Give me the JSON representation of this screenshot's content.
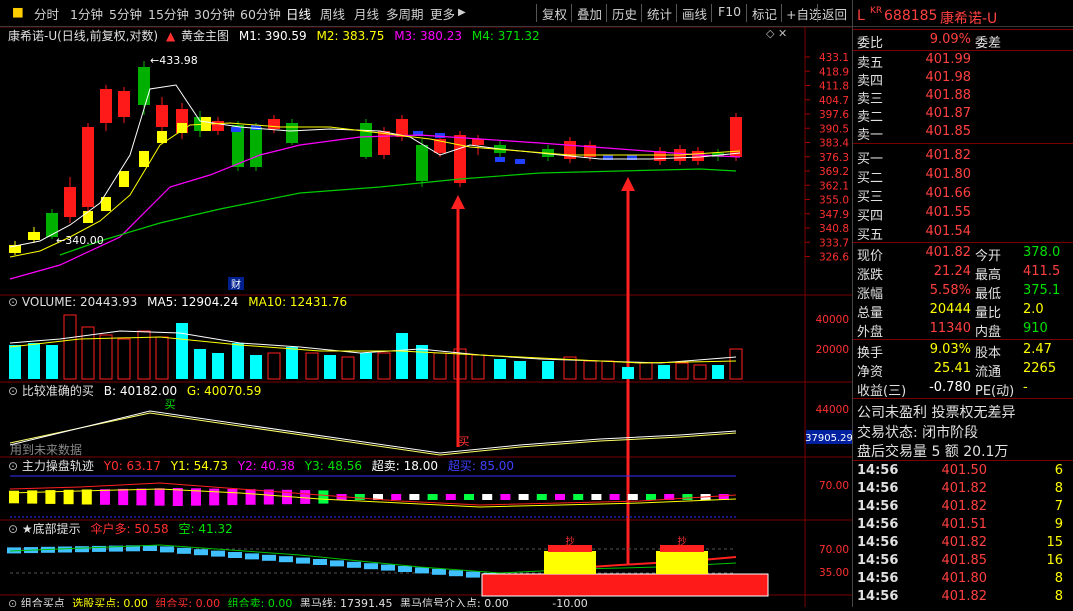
{
  "toolbar": {
    "periods": [
      "分时",
      "1分钟",
      "5分钟",
      "15分钟",
      "30分钟",
      "60分钟",
      "日线",
      "周线",
      "月线",
      "多周期",
      "更多"
    ],
    "active_period": "日线",
    "tools": [
      "复权",
      "叠加",
      "历史",
      "统计",
      "画线",
      "F10",
      "标记",
      "+自选",
      "返回"
    ]
  },
  "main_chart": {
    "title": "康希诺-U(日线,前复权,对数)",
    "indicator": "黄金主图",
    "m1_label": "M1: 390.59",
    "m2_label": "M2: 383.75",
    "m3_label": "M3: 380.23",
    "m4_label": "M4: 371.32",
    "high_mark": "433.98",
    "low_mark": "340.00",
    "cai_badge": "财",
    "y_ticks": [
      "433.1",
      "418.9",
      "411.8",
      "404.7",
      "397.6",
      "390.5",
      "383.4",
      "376.3",
      "369.2",
      "362.1",
      "355.0",
      "347.9",
      "340.8",
      "333.7",
      "326.6"
    ]
  },
  "volume_panel": {
    "title": "VOLUME: 20443.93",
    "ma5": "MA5: 12904.24",
    "ma10": "MA10: 12431.76",
    "y_ticks": [
      "40000",
      "20000"
    ]
  },
  "panel_buy": {
    "title": "比较准确的买",
    "b_label": "B: 40182.00",
    "g_label": "G: 40070.59",
    "buy_label": "买",
    "buy_label2": "买",
    "no_data": "用到未来数据",
    "y_tick": "44000",
    "price_box": "37905.29"
  },
  "panel_main_force": {
    "title": "主力操盘轨迹",
    "y0": "Y0: 63.17",
    "y1": "Y1: 54.73",
    "y2": "Y2: 40.38",
    "y3": "Y3: 48.56",
    "oversell": "超卖: 18.00",
    "overbuy": "超买: 85.00",
    "y_tick": "70.00"
  },
  "panel_bottom": {
    "title": "★底部提示",
    "san_hu": "伞户多: 50.58",
    "kong": "空: 41.32",
    "y_ticks": [
      "70.00",
      "35.00"
    ],
    "bubble1": "抄",
    "bubble2": "抄"
  },
  "footer": {
    "items": [
      "组合买点",
      "选股买点: 0.00",
      "组合买: 0.00",
      "组合卖: 0.00",
      "黑马线: 17391.45",
      "黑马信号介入点: 0.00"
    ],
    "value": "-10.00"
  },
  "quote": {
    "code": "688185",
    "name": "康希诺-U",
    "kr_tag": "KR",
    "l_tag": "L",
    "webi_label": "委比",
    "webi_value": "9.09%",
    "wecha_label": "委差",
    "asks": [
      {
        "label": "卖五",
        "price": "401.99"
      },
      {
        "label": "卖四",
        "price": "401.98"
      },
      {
        "label": "卖三",
        "price": "401.88"
      },
      {
        "label": "卖二",
        "price": "401.87"
      },
      {
        "label": "卖一",
        "price": "401.85"
      }
    ],
    "bids": [
      {
        "label": "买一",
        "price": "401.82"
      },
      {
        "label": "买二",
        "price": "401.80"
      },
      {
        "label": "买三",
        "price": "401.66"
      },
      {
        "label": "买四",
        "price": "401.55"
      },
      {
        "label": "买五",
        "price": "401.54"
      }
    ],
    "stats": [
      {
        "l1": "现价",
        "v1": "401.82",
        "l2": "今开",
        "v2": "378.0"
      },
      {
        "l1": "涨跌",
        "v1": "21.24",
        "l2": "最高",
        "v2": "411.5"
      },
      {
        "l1": "涨幅",
        "v1": "5.58%",
        "l2": "最低",
        "v2": "375.1"
      },
      {
        "l1": "总量",
        "v1": "20444",
        "l2": "量比",
        "v2": "2.0"
      },
      {
        "l1": "外盘",
        "v1": "11340",
        "l2": "内盘",
        "v2": "910"
      }
    ],
    "stats2": [
      {
        "l1": "换手",
        "v1": "9.03%",
        "l2": "股本",
        "v2": "2.47"
      },
      {
        "l1": "净资",
        "v1": "25.41",
        "l2": "流通",
        "v2": "2265"
      },
      {
        "l1": "收益(三)",
        "v1": "-0.780",
        "l2": "PE(动)",
        "v2": "-"
      }
    ],
    "company_line": "公司未盈利 投票权无差异",
    "trade_status": "交易状态: 闭市阶段",
    "after_hours": "盘后交易量 5 额 20.1万",
    "ticks": [
      {
        "time": "14:56",
        "price": "401.50",
        "vol": "6"
      },
      {
        "time": "14:56",
        "price": "401.82",
        "vol": "8"
      },
      {
        "time": "14:56",
        "price": "401.82",
        "vol": "7"
      },
      {
        "time": "14:56",
        "price": "401.51",
        "vol": "9"
      },
      {
        "time": "14:56",
        "price": "401.82",
        "vol": "15"
      },
      {
        "time": "14:56",
        "price": "401.85",
        "vol": "16"
      },
      {
        "time": "14:56",
        "price": "401.80",
        "vol": "8"
      },
      {
        "time": "14:56",
        "price": "401.82",
        "vol": "8"
      }
    ]
  },
  "colors": {
    "up": "#ff2020",
    "down": "#00c000",
    "volume_down": "#00ffff",
    "gold": "#ffff00",
    "magenta": "#ff00ff"
  }
}
